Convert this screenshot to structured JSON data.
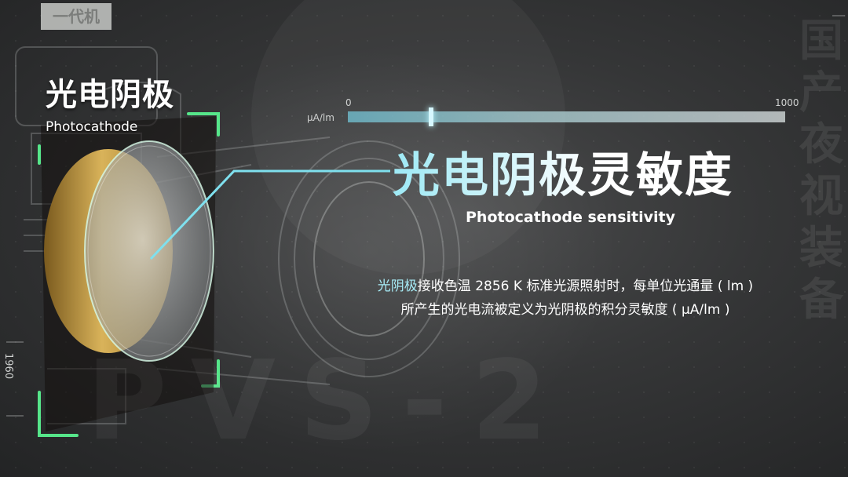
{
  "badge": {
    "label": "一代机"
  },
  "component": {
    "title_zh": "光电阴极",
    "title_en": "Photocathode"
  },
  "year": "1960",
  "scale": {
    "unit": "µA/lm",
    "min_label": "0",
    "max_label": "1000",
    "marker_value": 190
  },
  "heading": {
    "zh": "光电阴极灵敏度",
    "en": "Photocathode sensitivity"
  },
  "description": {
    "line1_highlight": "光阴极",
    "line1_rest": "接收色温 2856 K 标准光源照射时，每单位光通量 ( lm )",
    "line2_rest": "所产生的光电流被定义为光阴极的积分灵敏度 ( µA/lm )"
  },
  "watermark": {
    "text": "PVS-2",
    "vertical": "国产夜视装备"
  },
  "colors": {
    "accent_green": "#56e68a",
    "accent_cyan": "#7fe0ee",
    "lens_gold": "#c9a04a"
  }
}
